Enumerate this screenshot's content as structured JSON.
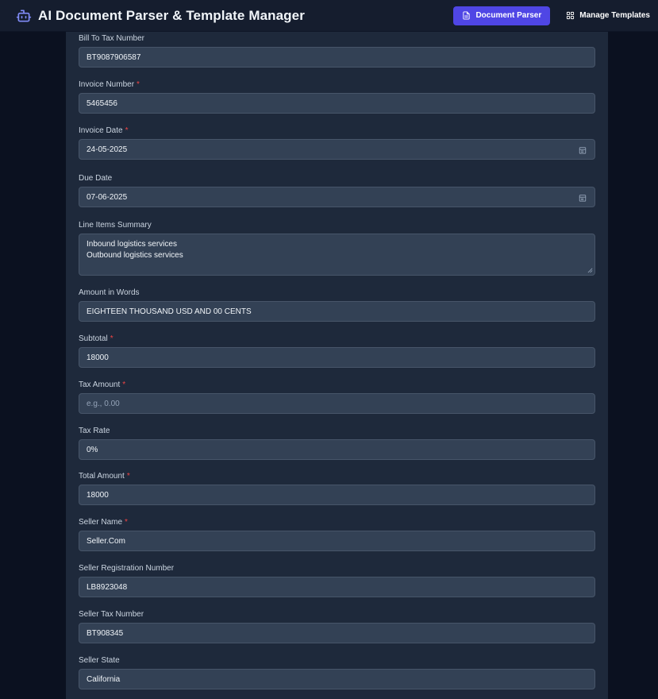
{
  "header": {
    "title": "AI Document Parser & Template Manager",
    "logo_icon": "robot-icon",
    "nav": [
      {
        "label": "Document Parser",
        "icon": "document-icon",
        "active": true
      },
      {
        "label": "Manage Templates",
        "icon": "grid-icon",
        "active": false
      }
    ]
  },
  "colors": {
    "accent": "#4f46e5",
    "required": "#ef4444",
    "panel": "#1e293b",
    "input": "#334155"
  },
  "form": {
    "fields": [
      {
        "label": "Bill To Tax Number",
        "required": false,
        "value": "BT9087906587",
        "type": "text"
      },
      {
        "label": "Invoice Number",
        "required": true,
        "value": "5465456",
        "type": "text"
      },
      {
        "label": "Invoice Date",
        "required": true,
        "value": "24-05-2025",
        "type": "date"
      },
      {
        "label": "Due Date",
        "required": false,
        "value": "07-06-2025",
        "type": "date"
      },
      {
        "label": "Line Items Summary",
        "required": false,
        "type": "textarea",
        "lines": [
          "Inbound logistics services",
          "Outbound logistics services"
        ]
      },
      {
        "label": "Amount in Words",
        "required": false,
        "value": "EIGHTEEN THOUSAND USD AND 00 CENTS",
        "type": "text"
      },
      {
        "label": "Subtotal",
        "required": true,
        "value": "18000",
        "type": "text"
      },
      {
        "label": "Tax Amount",
        "required": true,
        "value": "",
        "placeholder": "e.g., 0.00",
        "type": "text"
      },
      {
        "label": "Tax Rate",
        "required": false,
        "value": "0%",
        "type": "text"
      },
      {
        "label": "Total Amount",
        "required": true,
        "value": "18000",
        "type": "text"
      },
      {
        "label": "Seller Name",
        "required": true,
        "value": "Seller.Com",
        "type": "text"
      },
      {
        "label": "Seller Registration Number",
        "required": false,
        "value": "LB8923048",
        "type": "text"
      },
      {
        "label": "Seller Tax Number",
        "required": false,
        "value": "BT908345",
        "type": "text"
      },
      {
        "label": "Seller State",
        "required": false,
        "value": "California",
        "type": "text"
      }
    ]
  }
}
